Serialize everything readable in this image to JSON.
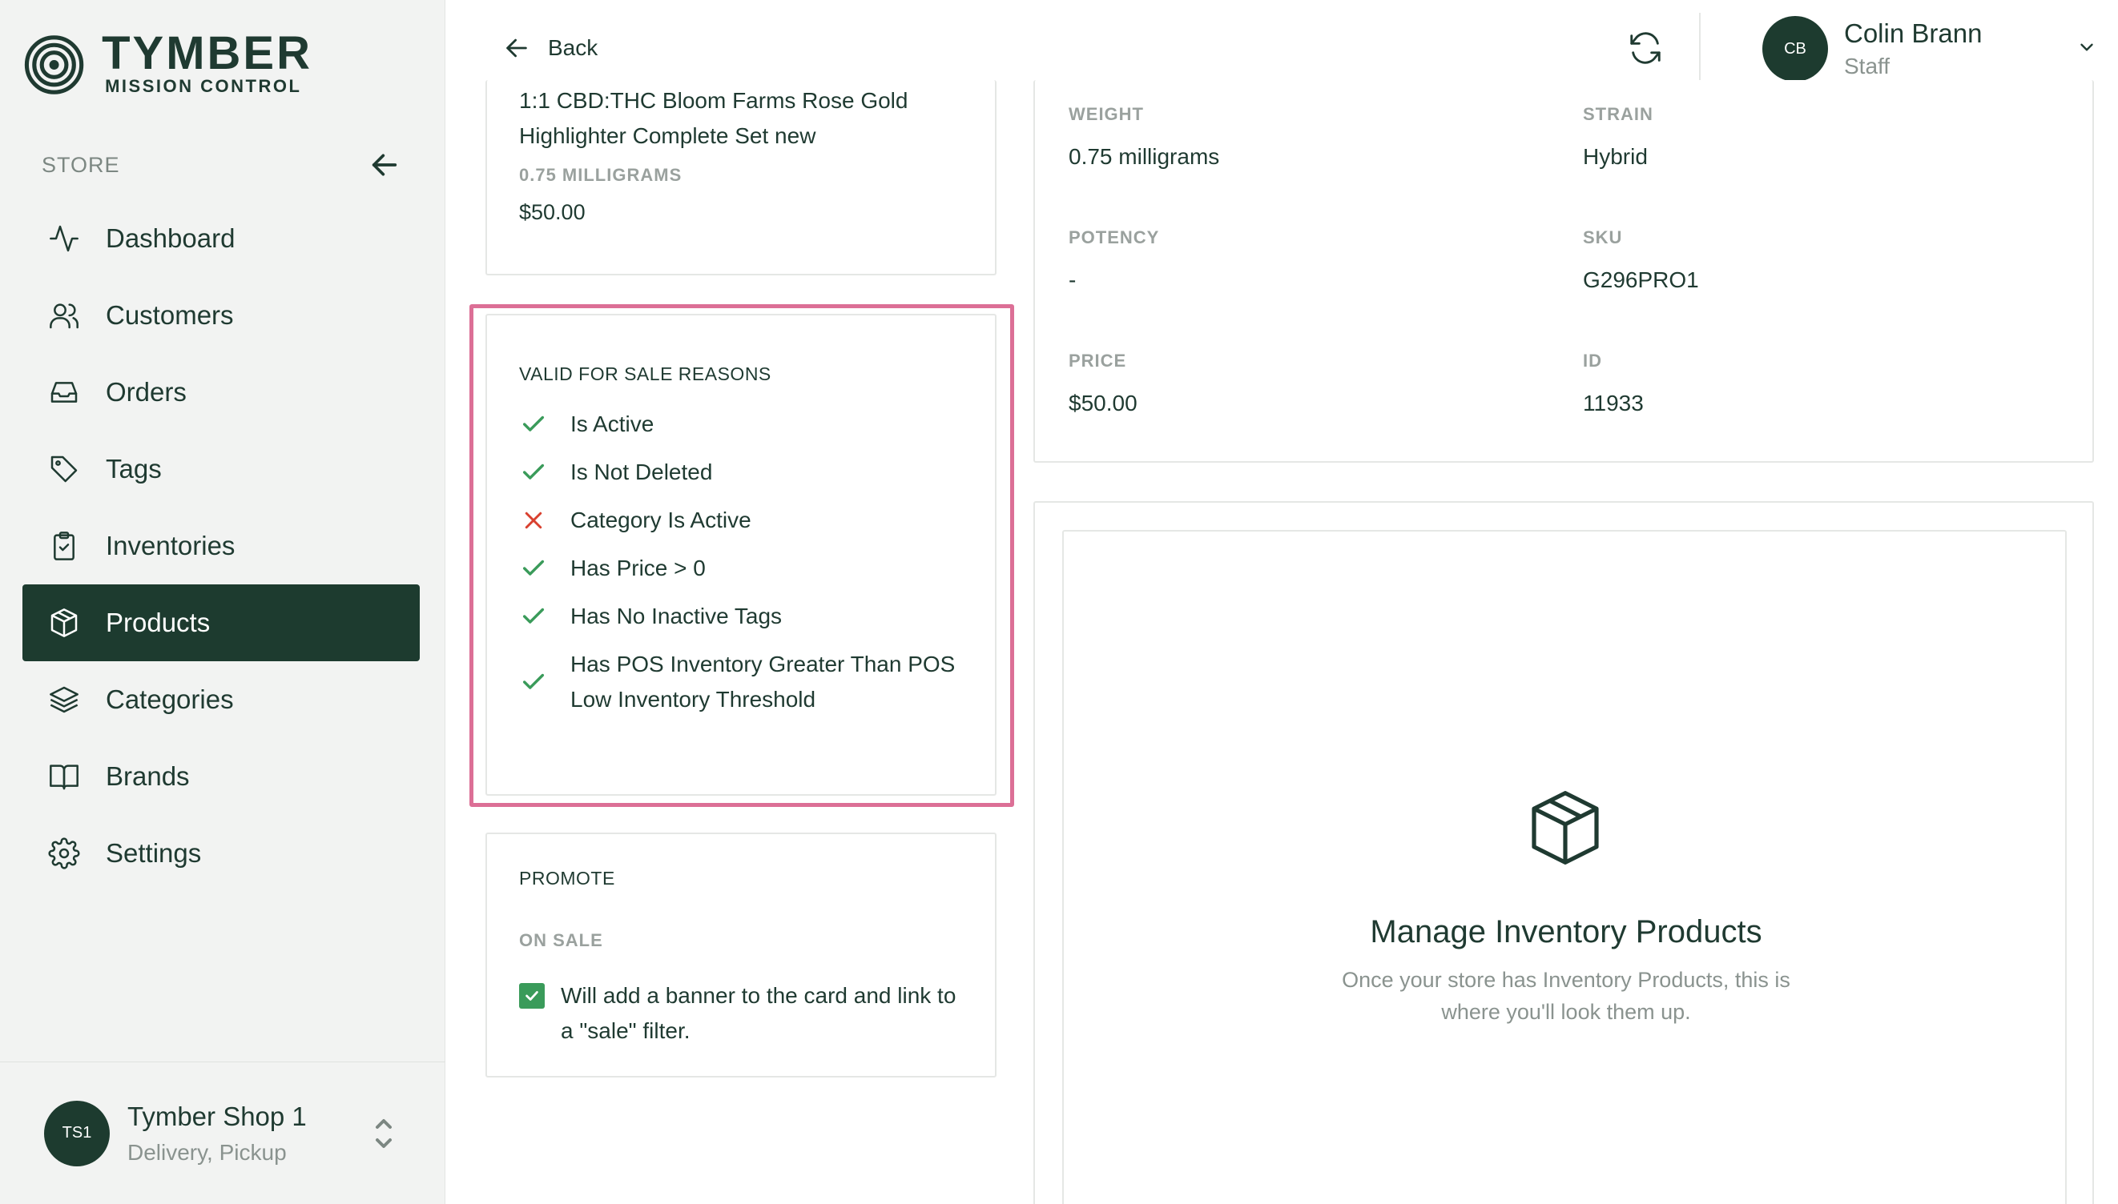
{
  "brand": {
    "name": "TYMBER",
    "subtitle": "MISSION CONTROL"
  },
  "sidebar": {
    "section_label": "STORE",
    "items": [
      {
        "label": "Dashboard",
        "icon": "activity-icon",
        "active": false
      },
      {
        "label": "Customers",
        "icon": "users-icon",
        "active": false
      },
      {
        "label": "Orders",
        "icon": "inbox-icon",
        "active": false
      },
      {
        "label": "Tags",
        "icon": "tag-icon",
        "active": false
      },
      {
        "label": "Inventories",
        "icon": "clipboard-check-icon",
        "active": false
      },
      {
        "label": "Products",
        "icon": "box-icon",
        "active": true
      },
      {
        "label": "Categories",
        "icon": "layers-icon",
        "active": false
      },
      {
        "label": "Brands",
        "icon": "book-open-icon",
        "active": false
      },
      {
        "label": "Settings",
        "icon": "gear-icon",
        "active": false
      }
    ],
    "shop": {
      "initials": "TS1",
      "name": "Tymber Shop 1",
      "fulfillment": "Delivery, Pickup"
    }
  },
  "topbar": {
    "back_label": "Back",
    "user": {
      "initials": "CB",
      "name": "Colin Brann",
      "role": "Staff"
    }
  },
  "product_card": {
    "name": "1:1 CBD:THC Bloom Farms Rose Gold Highlighter Complete Set new",
    "weight": "0.75 MILLIGRAMS",
    "price": "$50.00"
  },
  "valid_for_sale": {
    "title": "VALID FOR SALE REASONS",
    "reasons": [
      {
        "label": "Is Active",
        "valid": true
      },
      {
        "label": "Is Not Deleted",
        "valid": true
      },
      {
        "label": "Category Is Active",
        "valid": false
      },
      {
        "label": "Has Price > 0",
        "valid": true
      },
      {
        "label": "Has No Inactive Tags",
        "valid": true
      },
      {
        "label": "Has POS Inventory Greater Than POS Low Inventory Threshold",
        "valid": true
      }
    ]
  },
  "promote": {
    "title": "PROMOTE",
    "on_sale_label": "ON SALE",
    "on_sale_checked": true,
    "on_sale_text": "Will add a banner to the card and link to a \"sale\" filter."
  },
  "details": {
    "weight": {
      "label": "WEIGHT",
      "value": "0.75 milligrams"
    },
    "strain": {
      "label": "STRAIN",
      "value": "Hybrid"
    },
    "potency": {
      "label": "POTENCY",
      "value": "-"
    },
    "sku": {
      "label": "SKU",
      "value": "G296PRO1"
    },
    "price": {
      "label": "PRICE",
      "value": "$50.00"
    },
    "id": {
      "label": "ID",
      "value": "11933"
    }
  },
  "inventory_empty": {
    "title": "Manage Inventory Products",
    "description": "Once your store has Inventory Products, this is where you'll look them up."
  },
  "colors": {
    "primary": "#1d3b2f",
    "success": "#3a9b5a",
    "error": "#d9402f",
    "highlight": "#dc6f96",
    "sidebar_bg": "#f2f3f2"
  }
}
